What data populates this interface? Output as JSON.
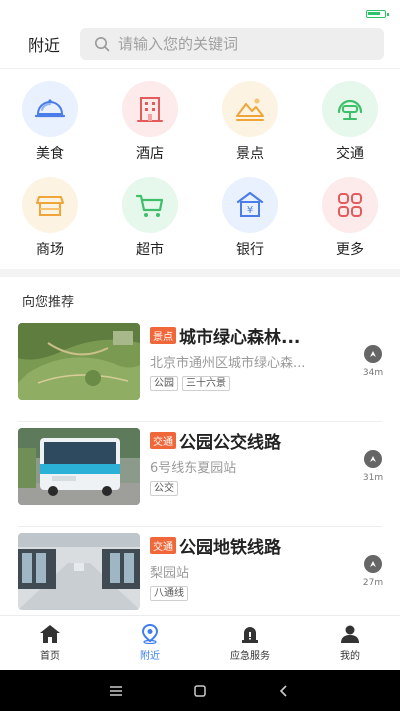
{
  "header": {
    "title": "附近",
    "search_placeholder": "请输入您的关键词"
  },
  "categories": [
    {
      "label": "美食",
      "icon": "food-dome-icon",
      "bg": "#eaf1fe",
      "fg": "#4a7de8"
    },
    {
      "label": "酒店",
      "icon": "hotel-building-icon",
      "bg": "#fdeaea",
      "fg": "#e45b5b"
    },
    {
      "label": "景点",
      "icon": "mountain-scenery-icon",
      "bg": "#fdf3e2",
      "fg": "#f0a53a"
    },
    {
      "label": "交通",
      "icon": "transport-icon",
      "bg": "#e6f7ec",
      "fg": "#3fbf6a"
    },
    {
      "label": "商场",
      "icon": "mall-store-icon",
      "bg": "#fdf3e2",
      "fg": "#f0a53a"
    },
    {
      "label": "超市",
      "icon": "shopping-cart-icon",
      "bg": "#e6f7ec",
      "fg": "#3fbf6a"
    },
    {
      "label": "银行",
      "icon": "bank-icon",
      "bg": "#eaf1fe",
      "fg": "#4a7de8"
    },
    {
      "label": "更多",
      "icon": "more-grid-icon",
      "bg": "#fdeaea",
      "fg": "#e45b5b"
    }
  ],
  "section_title": "向您推荐",
  "recommendations": [
    {
      "tag": "景点",
      "name": "城市绿心森林...",
      "address": "北京市通州区城市绿心森...",
      "chips": [
        "公园",
        "三十六景"
      ],
      "distance": "34m"
    },
    {
      "tag": "交通",
      "name": "公园公交线路",
      "address": "6号线东夏园站",
      "chips": [
        "公交"
      ],
      "distance": "31m"
    },
    {
      "tag": "交通",
      "name": "公园地铁线路",
      "address": "梨园站",
      "chips": [
        "八通线"
      ],
      "distance": "27m"
    }
  ],
  "tabs": [
    {
      "label": "首页",
      "icon": "home-icon"
    },
    {
      "label": "附近",
      "icon": "location-pin-icon"
    },
    {
      "label": "应急服务",
      "icon": "emergency-light-icon"
    },
    {
      "label": "我的",
      "icon": "user-icon"
    }
  ],
  "colors": {
    "accent": "#3d7ef0",
    "tag": "#f0683a"
  }
}
